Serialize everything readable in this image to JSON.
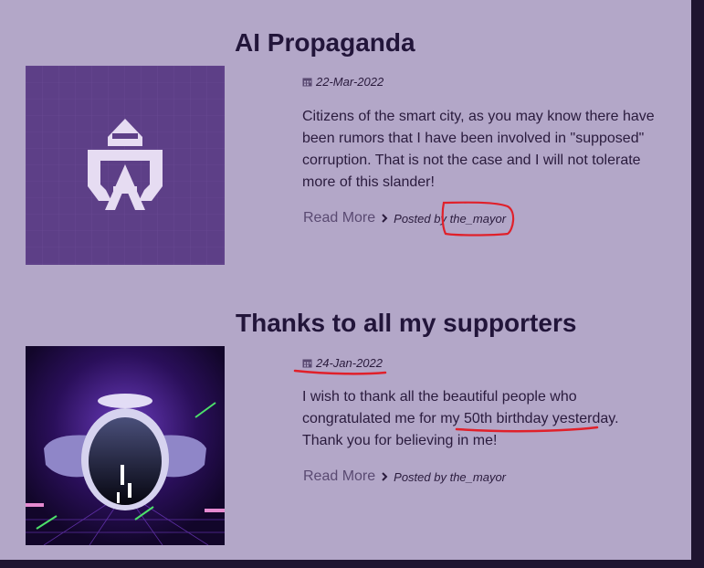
{
  "posts": [
    {
      "title": "AI Propaganda",
      "date": "22-Mar-2022",
      "excerpt": "Citizens of the smart city, as you may know there have been rumors that I have been involved in \"supposed\" corruption. That is not the case and I will not tolerate more of this slander!",
      "read_more": "Read More",
      "posted_by_prefix": "Posted by",
      "author": "the_mayor",
      "image": "hooded-hacker-logo"
    },
    {
      "title": "Thanks to all my supporters",
      "date": "24-Jan-2022",
      "excerpt_part1": "I wish to thank all the beautiful people who congratulated me for my ",
      "excerpt_highlight": "50th birthday yesterday",
      "excerpt_part2": ". Thank you for believing in me!",
      "read_more": "Read More",
      "posted_by": "Posted by the_mayor",
      "image": "futuristic-robot-head"
    }
  ],
  "colors": {
    "background": "#b3a7c8",
    "title": "#22153a",
    "link": "#5a4a72",
    "annotation": "#e0202a",
    "frame": "#1f1430"
  },
  "icons": [
    "calendar-icon",
    "chevron-right-icon"
  ]
}
